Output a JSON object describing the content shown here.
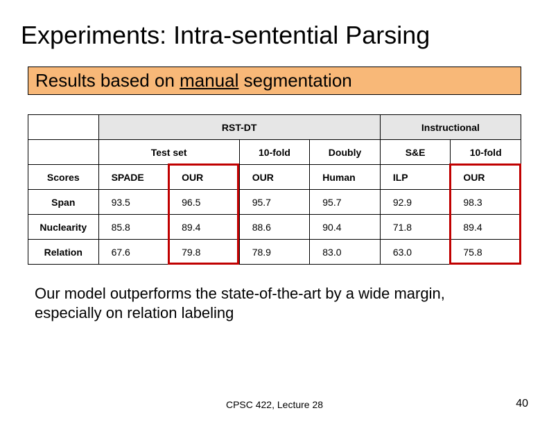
{
  "title": "Experiments: Intra-sentential Parsing",
  "subtitle": {
    "pre": "Results based on ",
    "underline": "manual",
    "post": " segmentation"
  },
  "table": {
    "dataset_headers": {
      "rst": "RST-DT",
      "instr": "Instructional"
    },
    "col_headers": {
      "scores": "Scores",
      "testset": "Test set",
      "tenfold": "10-fold",
      "doubly": "Doubly",
      "se": "S&E",
      "tenfold2": "10-fold"
    },
    "system_row": {
      "spade": "SPADE",
      "our": "OUR",
      "human": "Human",
      "ilp": "ILP"
    },
    "rows": [
      {
        "label": "Span",
        "vals": [
          "93.5",
          "96.5",
          "95.7",
          "95.7",
          "92.9",
          "98.3"
        ]
      },
      {
        "label": "Nuclearity",
        "vals": [
          "85.8",
          "89.4",
          "88.6",
          "90.4",
          "71.8",
          "89.4"
        ]
      },
      {
        "label": "Relation",
        "vals": [
          "67.6",
          "79.8",
          "78.9",
          "83.0",
          "63.0",
          "75.8"
        ]
      }
    ]
  },
  "body_text": "Our model outperforms the state-of-the-art by a wide margin, especially on relation labeling",
  "footer_center": "CPSC 422, Lecture 28",
  "footer_right": "40",
  "chart_data": {
    "type": "table",
    "title": "Intra-sentential Parsing Results (manual segmentation)",
    "columns": [
      "Scores",
      "RST-DT / Test set / SPADE",
      "RST-DT / Test set / OUR",
      "RST-DT / 10-fold / OUR",
      "RST-DT / Doubly / Human",
      "Instructional / S&E / ILP",
      "Instructional / 10-fold / OUR"
    ],
    "rows": [
      [
        "Span",
        93.5,
        96.5,
        95.7,
        95.7,
        92.9,
        98.3
      ],
      [
        "Nuclearity",
        85.8,
        89.4,
        88.6,
        90.4,
        71.8,
        89.4
      ],
      [
        "Relation",
        67.6,
        79.8,
        78.9,
        83.0,
        63.0,
        75.8
      ]
    ]
  }
}
